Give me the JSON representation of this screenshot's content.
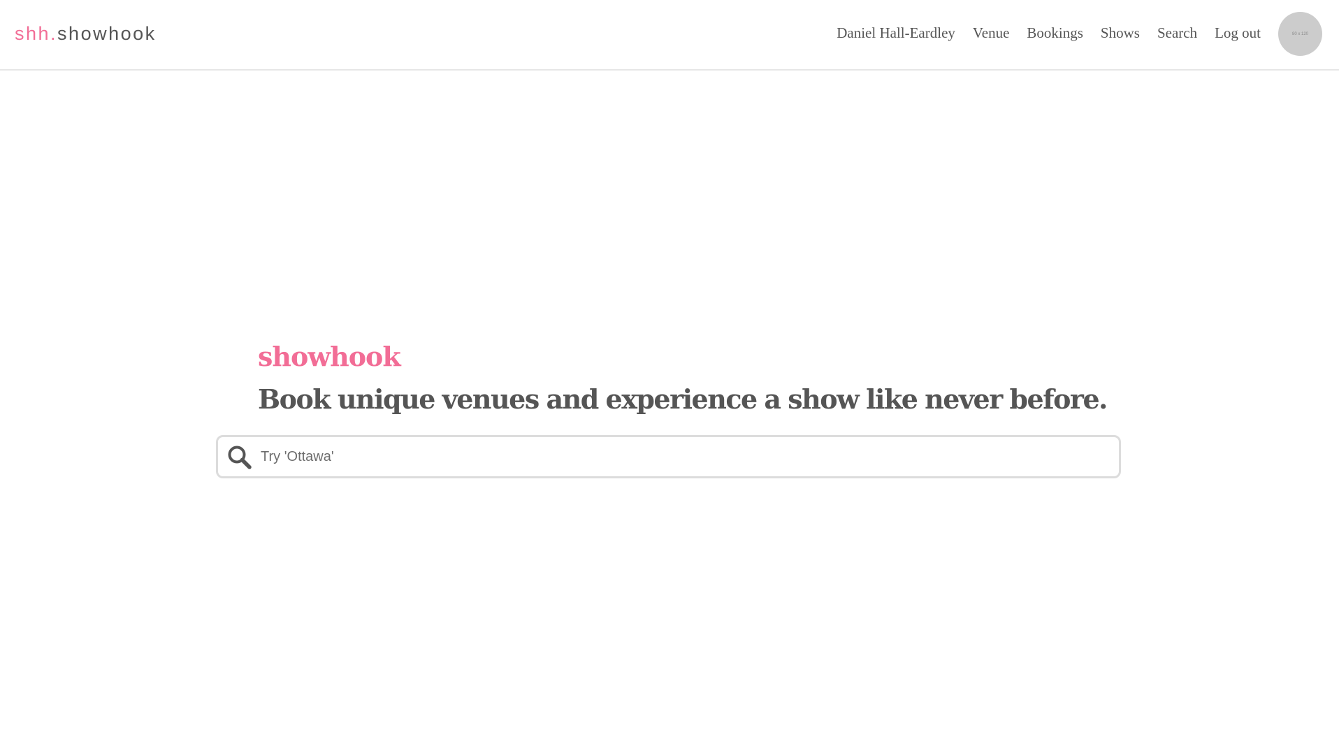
{
  "header": {
    "logo_prefix": "shh.",
    "logo_name": "showhook",
    "nav": {
      "user_name": "Daniel Hall-Eardley",
      "venue": "Venue",
      "bookings": "Bookings",
      "shows": "Shows",
      "search": "Search",
      "logout": "Log out"
    },
    "avatar_text": "80 x 120"
  },
  "hero": {
    "brand": "showhook",
    "tagline": "Book unique venues and experience a show like never before."
  },
  "search": {
    "value": "",
    "placeholder": "Try 'Ottawa'"
  },
  "colors": {
    "accent": "#f26d96",
    "text": "#555555",
    "avatar_bg": "#cccccc",
    "border": "#dcdcdc"
  },
  "icons": {
    "search": "search-icon"
  }
}
